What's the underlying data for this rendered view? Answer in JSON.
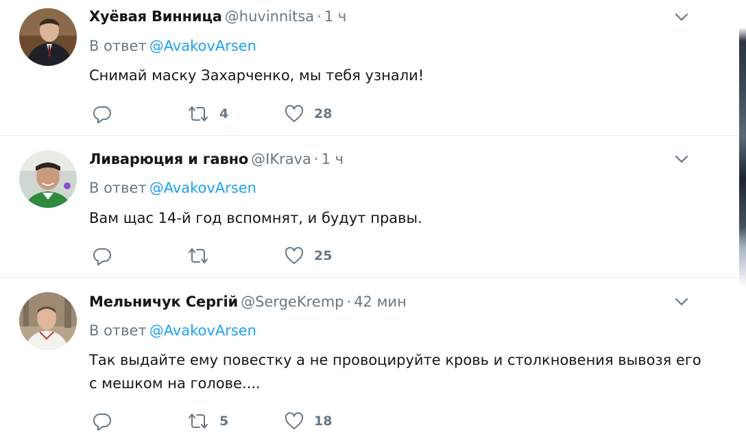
{
  "tweets": [
    {
      "name": "Хуёвая Винница",
      "handle": "@huvinnitsa",
      "dot": "·",
      "time": "1 ч",
      "reply_prefix": "В ответ",
      "reply_to": "@AvakovArsen",
      "text": "Снимай маску Захарченко, мы тебя узнали!",
      "retweets": "4",
      "likes": "28"
    },
    {
      "name": "Ливарюция и гавно",
      "handle": "@IKrava",
      "dot": "·",
      "time": "1 ч",
      "reply_prefix": "В ответ",
      "reply_to": "@AvakovArsen",
      "text": "Вам щас 14-й год вспомнят, и будут правы.",
      "retweets": "",
      "likes": "25"
    },
    {
      "name": "Мельничук Сергій",
      "handle": "@SergeKremp",
      "dot": "·",
      "time": "42 мин",
      "reply_prefix": "В ответ",
      "reply_to": "@AvakovArsen",
      "text": "Так выдайте ему повестку а не провоцируйте кровь и столкновения вывозя его с мешком на голове....",
      "retweets": "5",
      "likes": "18"
    }
  ],
  "icons": {
    "reply": "reply-icon",
    "retweet": "retweet-icon",
    "like": "heart-icon",
    "caret": "chevron-down-icon"
  },
  "colors": {
    "text": "#14171a",
    "muted": "#657786",
    "link": "#1da1f2",
    "divider": "#e6ecf0"
  }
}
